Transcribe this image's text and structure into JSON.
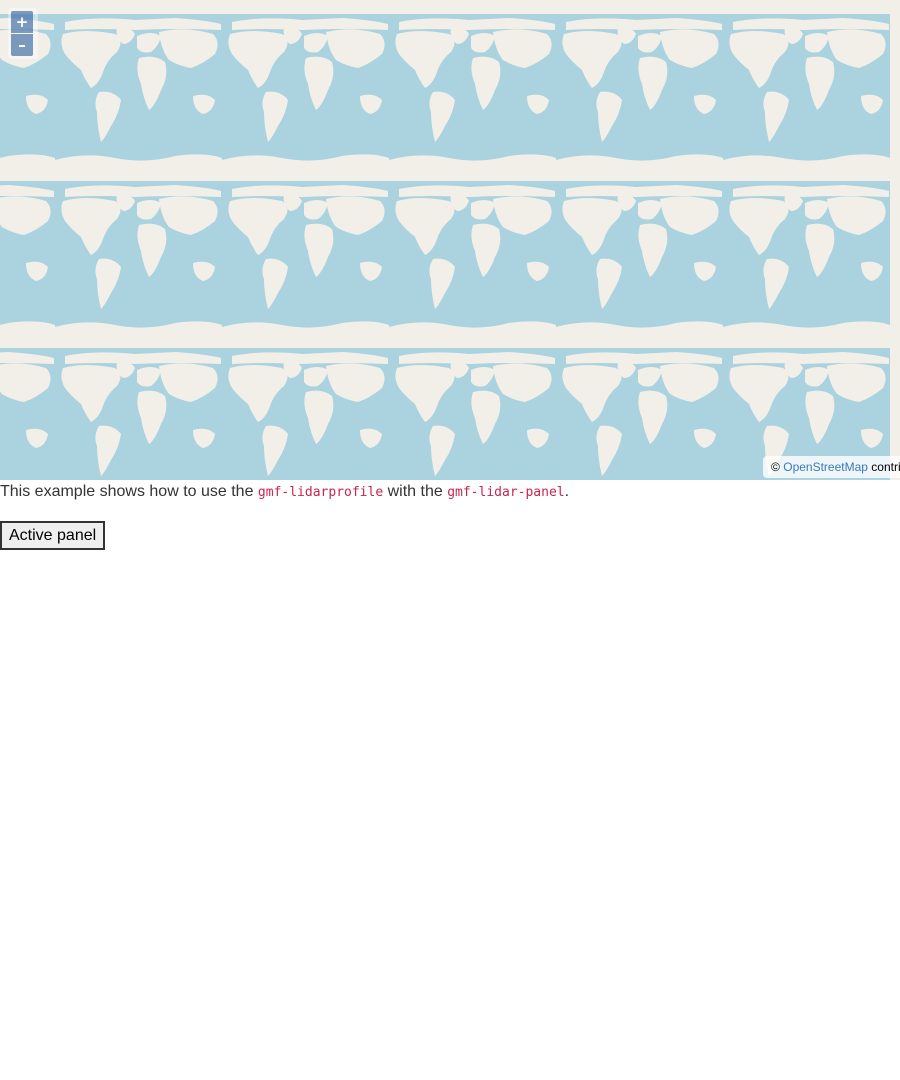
{
  "map": {
    "zoom_in_label": "+",
    "zoom_out_label": "–",
    "attribution_prefix": "©",
    "attribution_link": "OpenStreetMap",
    "attribution_suffix": "contributors",
    "ocean_color": "#aad3df",
    "land_color": "#f2efe9"
  },
  "description": {
    "text_1": "This example shows how to use the",
    "code_1": "gmf-lidarprofile",
    "text_2": "with the",
    "code_2": "gmf-lidar-panel",
    "text_3": "."
  },
  "active_panel_label": "Active panel"
}
